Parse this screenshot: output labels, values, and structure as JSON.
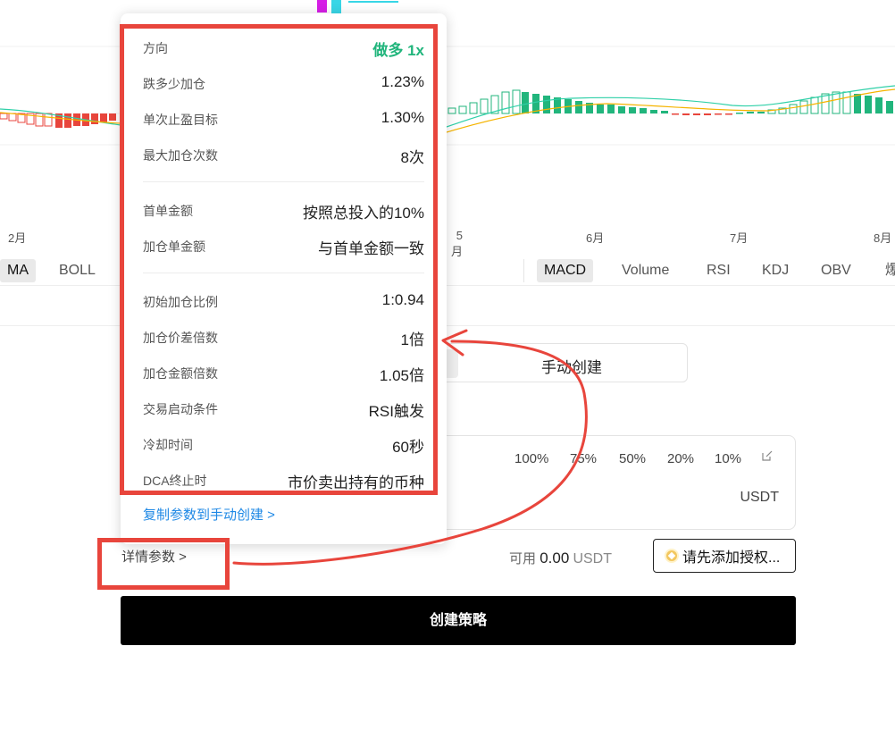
{
  "chart": {
    "months": [
      "2月",
      "6月",
      "7月",
      "8月"
    ],
    "partial_month": "5月",
    "indicator_tabs_left": [
      "MA",
      "BOLL"
    ],
    "indicator_tabs_right": [
      "MACD",
      "Volume",
      "RSI",
      "KDJ",
      "OBV",
      "爆"
    ],
    "active_tab": "MACD",
    "colors": {
      "up": "#21b57c",
      "down": "#e8453c",
      "dif": "#2fd0a8",
      "dea": "#f5b400"
    }
  },
  "popup": {
    "rows_group1": [
      {
        "label": "方向",
        "value": "做多 1x"
      },
      {
        "label": "跌多少加仓",
        "value": "1.23%"
      },
      {
        "label": "单次止盈目标",
        "value": "1.30%"
      },
      {
        "label": "最大加仓次数",
        "value": "8次"
      }
    ],
    "rows_group2": [
      {
        "label": "首单金额",
        "value": "按照总投入的10%"
      },
      {
        "label": "加仓单金额",
        "value": "与首单金额一致"
      }
    ],
    "rows_group3": [
      {
        "label": "初始加仓比例",
        "value": "1:0.94"
      },
      {
        "label": "加仓价差倍数",
        "value": "1倍"
      },
      {
        "label": "加仓金额倍数",
        "value": "1.05倍"
      },
      {
        "label": "交易启动条件",
        "value": "RSI触发"
      },
      {
        "label": "冷却时间",
        "value": "60秒"
      },
      {
        "label": "DCA终止时",
        "value": "市价卖出持有的币种"
      }
    ],
    "copy_link": "复制参数到手动创建 >"
  },
  "form": {
    "mode_manual": "手动创建",
    "percent_options": [
      "100%",
      "75%",
      "50%",
      "20%",
      "10%"
    ],
    "unit": "USDT",
    "available_label": "可用",
    "available_amount": "0.00",
    "available_currency": "USDT",
    "auth_button": "请先添加授权...",
    "detail_link": "详情参数 >",
    "create_button": "创建策略"
  },
  "annotation": {
    "color": "#e8453c"
  }
}
